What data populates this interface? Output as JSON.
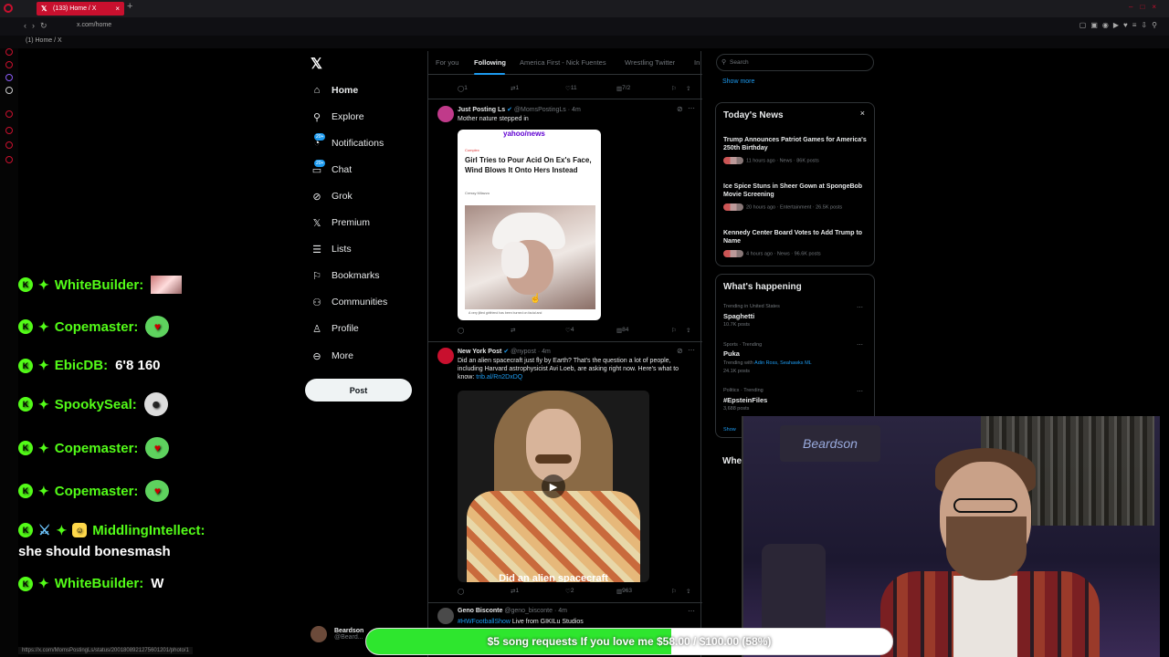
{
  "browser": {
    "tab_title": "(133) Home / X",
    "url": "x.com/home",
    "bookmark_label": "(1) Home / X",
    "status_url": "https://x.com/MomsPostingLs/status/2001808921275601201/photo/1"
  },
  "nav": {
    "items": [
      {
        "label": "Home",
        "icon": "home-icon"
      },
      {
        "label": "Explore",
        "icon": "search-icon"
      },
      {
        "label": "Notifications",
        "icon": "bell-icon",
        "badge": "20+"
      },
      {
        "label": "Chat",
        "icon": "chat-icon",
        "badge": "20+"
      },
      {
        "label": "Grok",
        "icon": "grok-icon"
      },
      {
        "label": "Premium",
        "icon": "x-icon"
      },
      {
        "label": "Lists",
        "icon": "list-icon"
      },
      {
        "label": "Bookmarks",
        "icon": "bookmark-icon"
      },
      {
        "label": "Communities",
        "icon": "people-icon"
      },
      {
        "label": "Profile",
        "icon": "person-icon"
      },
      {
        "label": "More",
        "icon": "more-circle-icon"
      }
    ],
    "post_label": "Post",
    "user_name": "Beardson",
    "user_handle": "@Beard..."
  },
  "feed": {
    "tabs": [
      "For you",
      "Following",
      "America First - Nick Fuentes",
      "Wrestling Twitter",
      "In"
    ],
    "active_tab": "Following",
    "top_actions": {
      "replies": "1",
      "reposts": "1",
      "likes": "11",
      "views": "7/2"
    },
    "tweets": [
      {
        "name": "Just Posting Ls",
        "handle": "@MomsPostingLs",
        "time": "4m",
        "text": "Mother nature stepped in",
        "card": {
          "source": "yahoo/news",
          "publisher": "Complex",
          "headline": "Girl Tries to Pour Acid On Ex's Face, Wind Blows It Onto Hers Instead",
          "byline": "Cressy Milazzo",
          "caption": "A very jilted girlfriend has been burned on facial and"
        },
        "actions": {
          "replies": "",
          "reposts": "",
          "likes": "4",
          "views": "84"
        }
      },
      {
        "name": "New York Post",
        "handle": "@nypost",
        "time": "4m",
        "text": "Did an alien spacecraft just fly by Earth? That's the question a lot of people, including Harvard astrophysicist Avi Loeb, are asking right now. Here's what to know:",
        "link": "trib.al/Rn2DxDQ",
        "video_caption": "Did an alien spacecraft",
        "actions": {
          "replies": "",
          "reposts": "1",
          "likes": "2",
          "views": "963"
        }
      },
      {
        "name": "Geno Bisconte",
        "handle": "@geno_bisconte",
        "time": "4m",
        "text": "Live from GIKILu Studios",
        "link": "#HWFootballShow"
      }
    ]
  },
  "right": {
    "search_placeholder": "Search",
    "show_more": "Show more",
    "news_title": "Today's News",
    "news": [
      {
        "headline": "Trump Announces Patriot Games for America's 250th Birthday",
        "meta": "11 hours ago · News · 86K posts"
      },
      {
        "headline": "Ice Spice Stuns in Sheer Gown at SpongeBob Movie Screening",
        "meta": "20 hours ago · Entertainment · 26.5K posts"
      },
      {
        "headline": "Kennedy Center Board Votes to Add Trump to Name",
        "meta": "4 hours ago · News · 96.6K posts"
      }
    ],
    "happening_title": "What's happening",
    "trends": [
      {
        "context": "Trending in United States",
        "name": "Spaghetti",
        "count": "10.7K posts"
      },
      {
        "context": "Sports · Trending",
        "name": "Puka",
        "extra_prefix": "Trending with",
        "extra_links": "Adin Ross, Seahawks ML",
        "count": "24.1K posts"
      },
      {
        "context": "Politics · Trending",
        "name": "#EpsteinFiles",
        "count": "3,688 posts"
      }
    ],
    "show_partial": "Show",
    "who_partial": "Whe"
  },
  "chat": [
    {
      "user": "WhiteBuilder:",
      "emote": "image"
    },
    {
      "user": "Copemaster:",
      "emote": "heart-eyes"
    },
    {
      "user": "EbicDB:",
      "message": "6'8 160"
    },
    {
      "user": "SpookySeal:",
      "emote": "ghost"
    },
    {
      "user": "Copemaster:",
      "emote": "heart-eyes"
    },
    {
      "user": "Copemaster:",
      "emote": "heart-eyes"
    },
    {
      "user": "MiddlingIntellect:",
      "message": "she should bonesmash"
    },
    {
      "user": "WhiteBuilder:",
      "message": "W"
    }
  ],
  "webcam": {
    "sign_text": "Beardson"
  },
  "goal": {
    "text": "$5 song requests If you love me $58.00 / $100.00 (58%)",
    "progress": 0.58,
    "fill_color": "#2ee62e"
  },
  "colors": {
    "accent": "#1d9bf0",
    "browser_accent": "#c8102e",
    "chat_green": "#53fc18"
  }
}
